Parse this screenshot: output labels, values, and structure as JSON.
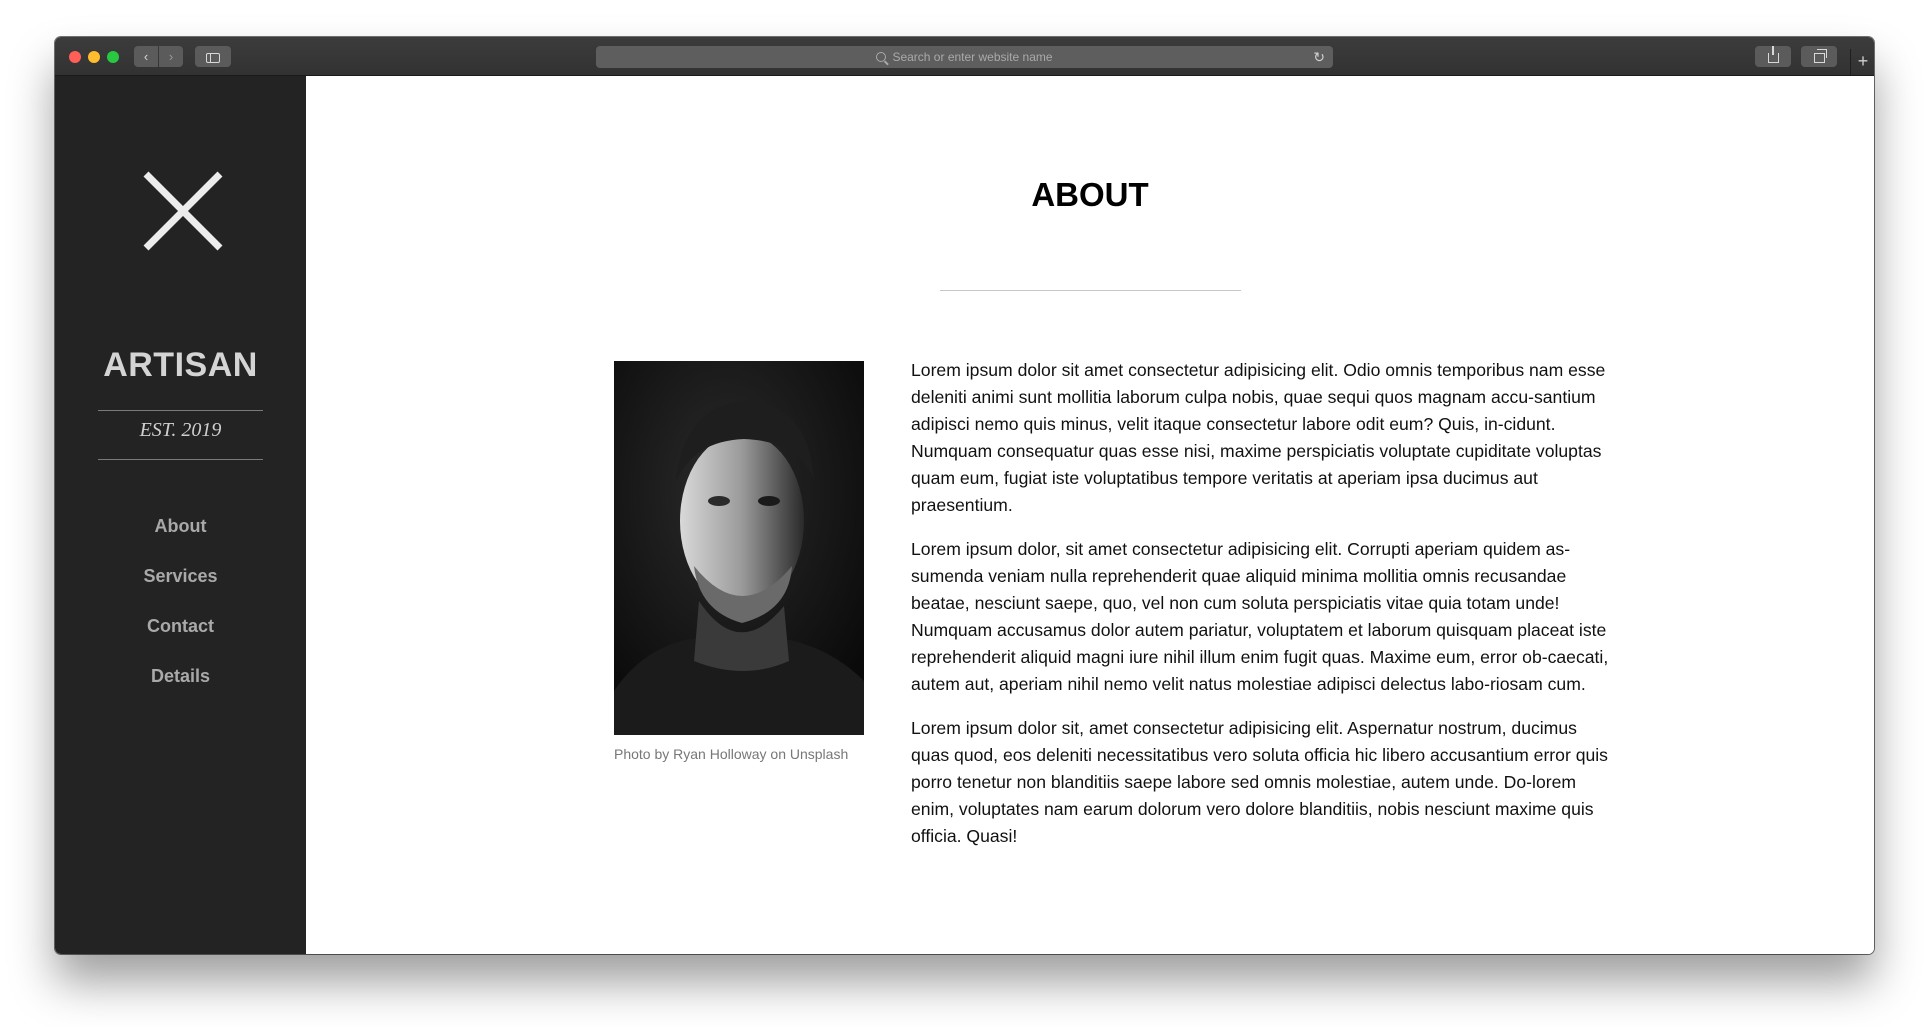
{
  "browser": {
    "url_placeholder": "Search or enter website name",
    "back_label": "‹",
    "forward_label": "›",
    "reload_label": "↻",
    "newtab_label": "+"
  },
  "sidebar": {
    "brand": "ARTISAN",
    "est": "EST. 2019",
    "nav": [
      {
        "label": "About"
      },
      {
        "label": "Services"
      },
      {
        "label": "Contact"
      },
      {
        "label": "Details"
      }
    ]
  },
  "main": {
    "title": "ABOUT",
    "photo_caption": "Photo by Ryan Holloway on Unsplash",
    "paragraphs": [
      "Lorem ipsum dolor sit amet consectetur adipisicing elit. Odio omnis temporibus nam esse deleniti animi sunt mollitia laborum culpa nobis, quae sequi quos magnam accu-santium adipisci nemo quis minus, velit itaque consectetur labore odit eum? Quis, in-cidunt. Numquam consequatur quas esse nisi, maxime perspiciatis voluptate cupiditate voluptas quam eum, fugiat iste voluptatibus tempore veritatis at aperiam ipsa ducimus aut praesentium.",
      "Lorem ipsum dolor, sit amet consectetur adipisicing elit. Corrupti aperiam quidem as-sumenda veniam nulla reprehenderit quae aliquid minima mollitia omnis recusandae beatae, nesciunt saepe, quo, vel non cum soluta perspiciatis vitae quia totam unde! Numquam accusamus dolor autem pariatur, voluptatem et laborum quisquam placeat iste reprehenderit aliquid magni iure nihil illum enim fugit quas. Maxime eum, error ob-caecati, autem aut, aperiam nihil nemo velit natus molestiae adipisci delectus labo-riosam cum.",
      "Lorem ipsum dolor sit, amet consectetur adipisicing elit. Aspernatur nostrum, ducimus quas quod, eos deleniti necessitatibus vero soluta officia hic libero accusantium error quis porro tenetur non blanditiis saepe labore sed omnis molestiae, autem unde. Do-lorem enim, voluptates nam earum dolorum vero dolore blanditiis, nobis nesciunt maxime quis officia. Quasi!"
    ]
  },
  "colors": {
    "sidebar_bg": "#232323",
    "nav_text": "#a9a9a9",
    "brand_text": "#d4d4d4"
  },
  "icons": [
    "close-icon",
    "back-icon",
    "forward-icon",
    "sidebar-toggle-icon",
    "search-icon",
    "reload-icon",
    "share-icon",
    "tabs-icon",
    "new-tab-icon"
  ]
}
